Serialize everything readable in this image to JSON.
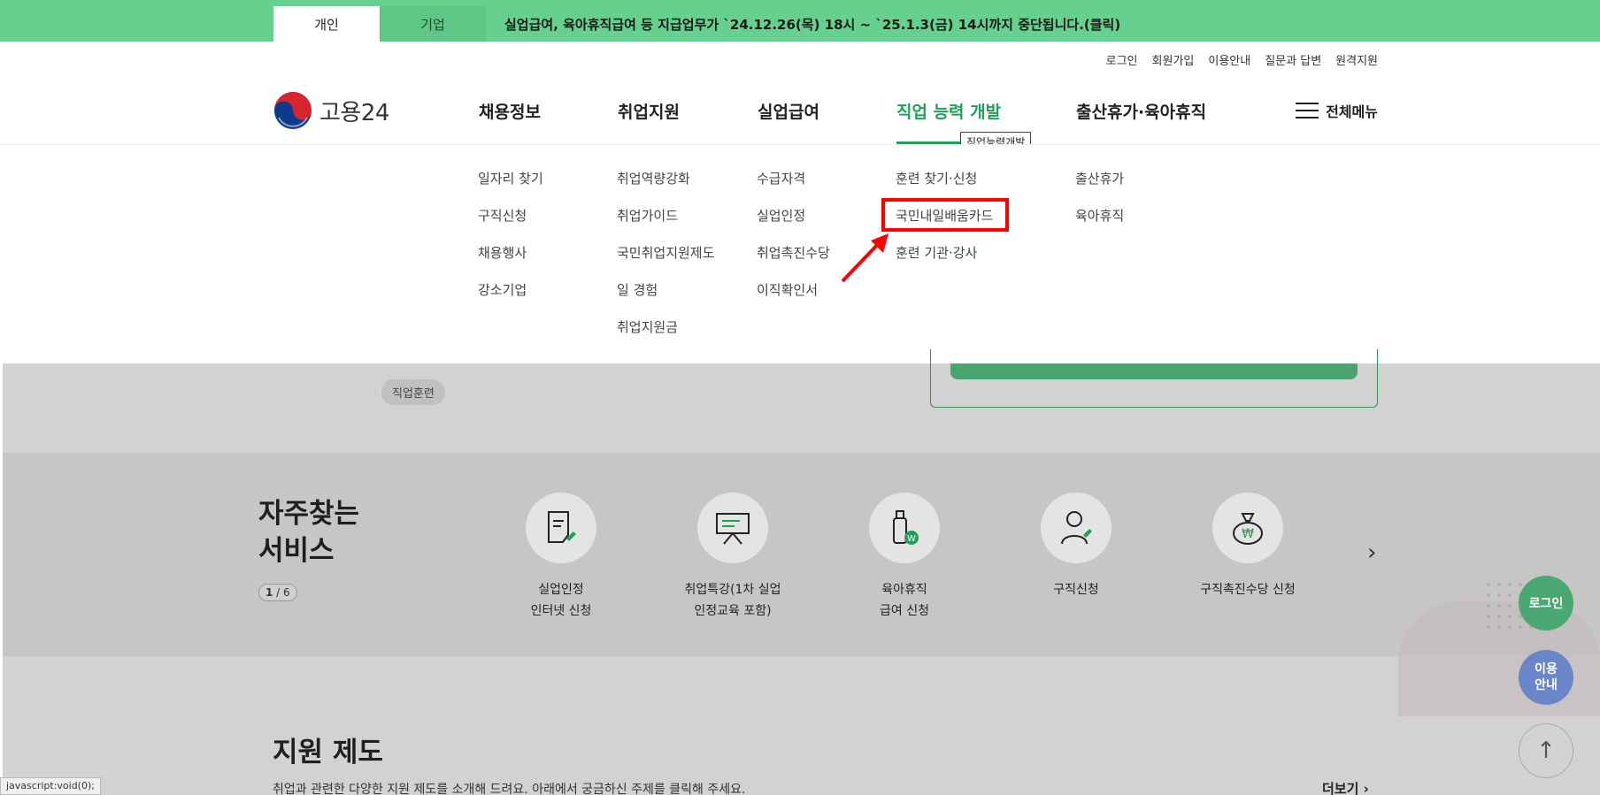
{
  "topbar": {
    "tab_personal": "개인",
    "tab_company": "기업",
    "notice": "실업급여, 육아휴직급여 등 지급업무가 `24.12.26(목) 18시 ~ `25.1.3(금) 14시까지 중단됩니다.(클릭)"
  },
  "utility": [
    "로그인",
    "회원가입",
    "이용안내",
    "질문과 답변",
    "원격지원"
  ],
  "logo": {
    "text": "고용24"
  },
  "gnb": {
    "items": [
      "채용정보",
      "취업지원",
      "실업급여",
      "직업 능력 개발",
      "출산휴가·육아휴직"
    ],
    "active_index": 3,
    "tooltip": "직업능력개발",
    "allmenu": "전체메뉴"
  },
  "dropdown": {
    "col1": [
      "일자리 찾기",
      "구직신청",
      "채용행사",
      "강소기업"
    ],
    "col2": [
      "취업역량강화",
      "취업가이드",
      "국민취업지원제도",
      "일 경험",
      "취업지원금"
    ],
    "col3": [
      "수급자격",
      "실업인정",
      "취업촉진수당",
      "이직확인서"
    ],
    "col4": [
      "훈련 찾기·신청",
      "국민내일배움카드",
      "훈련 기관·강사"
    ],
    "col5": [
      "출산휴가",
      "육아휴직"
    ]
  },
  "page": {
    "chip": "직업훈련",
    "freq_title_line1": "자주찾는",
    "freq_title_line2": "서비스",
    "pager_current": "1",
    "pager_total": " / 6",
    "services": [
      {
        "line1": "실업인정",
        "line2": "인터넷 신청",
        "icon": "document-pen-icon"
      },
      {
        "line1": "취업특강(1차 실업",
        "line2": "인정교육 포함)",
        "icon": "presentation-board-icon"
      },
      {
        "line1": "육아휴직",
        "line2": "급여 신청",
        "icon": "baby-bottle-won-icon"
      },
      {
        "line1": "구직신청",
        "line2": "",
        "icon": "person-pen-icon"
      },
      {
        "line1": "구직촉진수당 신청",
        "line2": "",
        "icon": "money-bag-won-icon"
      }
    ],
    "support_title": "지원 제도",
    "support_desc": "취업과 관련한 다양한 지원 제도를 소개해 드려요. 아래에서 궁금하신 주제를 클릭해 주세요.",
    "more": "더보기"
  },
  "floating": {
    "login": "로그인",
    "guide_line1": "이용",
    "guide_line2": "안내",
    "top": "↑"
  },
  "statusbar": "javascript:void(0);",
  "colors": {
    "topbar": "#66d08e",
    "accent": "#20a05a",
    "highlight": "#ff0000"
  }
}
